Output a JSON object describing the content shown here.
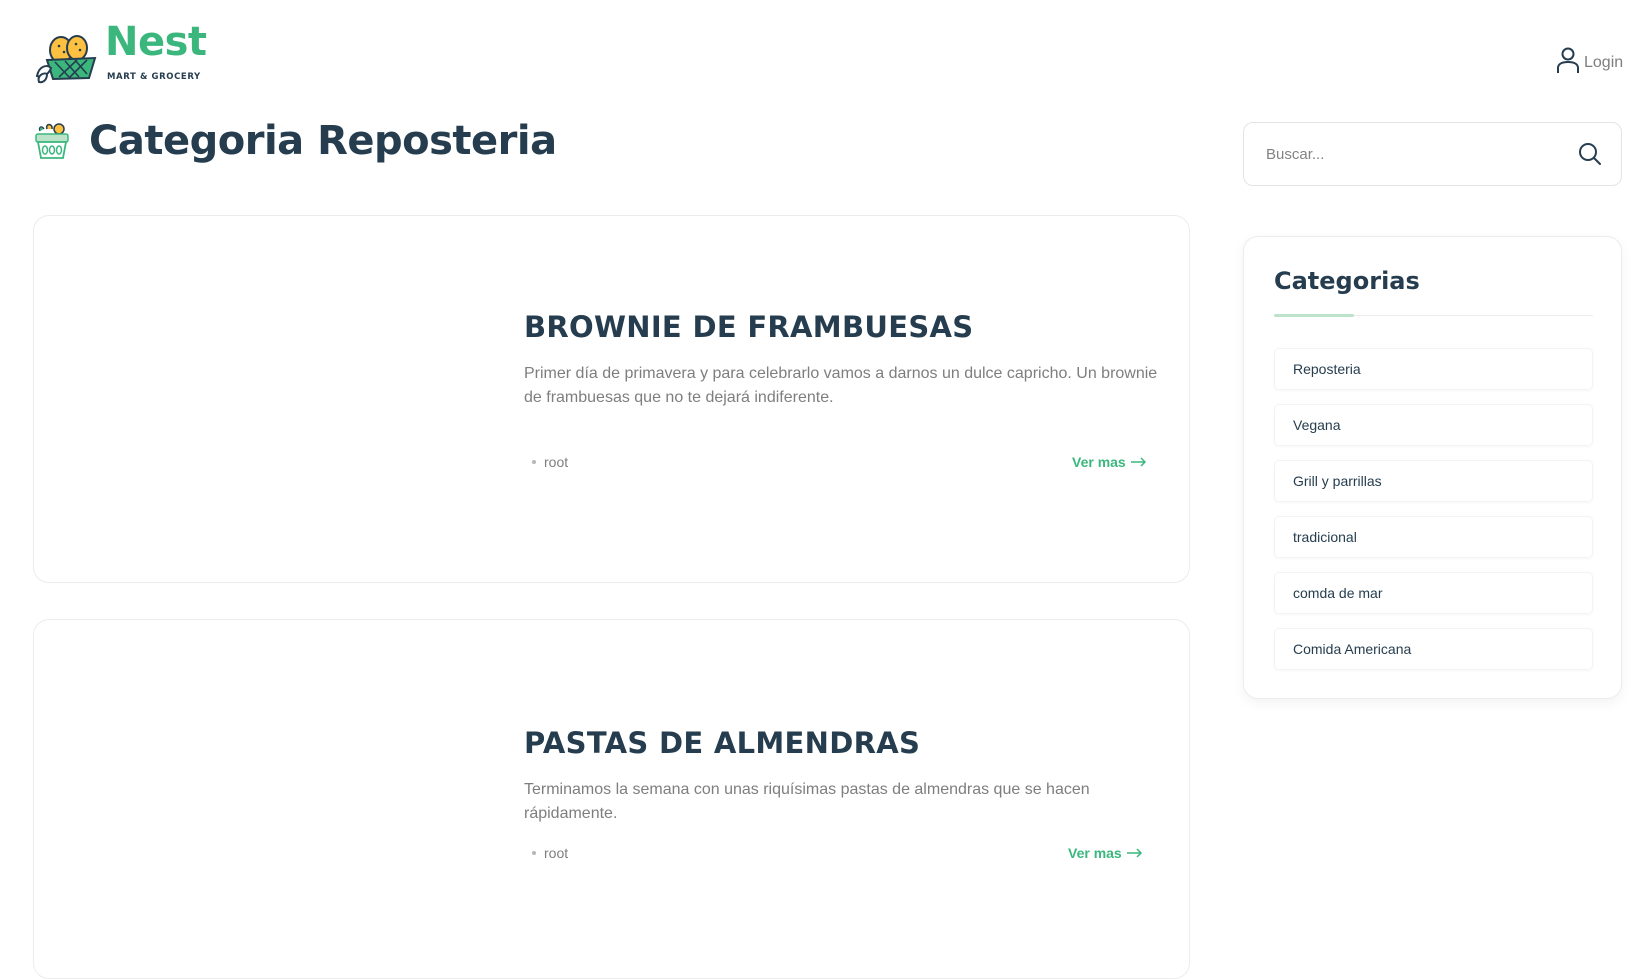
{
  "header": {
    "logo_name": "Nest",
    "logo_tagline": "MART & GROCERY",
    "login_label": "Login"
  },
  "page": {
    "title": "Categoria Reposteria"
  },
  "posts": [
    {
      "title": "BROWNIE DE FRAMBUESAS",
      "excerpt": "Primer día de primavera y para celebrarlo vamos a darnos un dulce capricho. Un brownie de frambuesas que no te dejará indiferente.",
      "author": "root",
      "read_more": "Ver mas"
    },
    {
      "title": "PASTAS DE ALMENDRAS",
      "excerpt": "Terminamos la semana con unas riquísimas pastas de almendras que se hacen rápidamente.",
      "author": "root",
      "read_more": "Ver mas"
    }
  ],
  "sidebar": {
    "search": {
      "placeholder": "Buscar..."
    },
    "categories": {
      "title": "Categorias",
      "items": [
        "Reposteria",
        "Vegana",
        "Grill y parrillas",
        "tradicional",
        "comda de mar",
        "Comida Americana"
      ]
    }
  },
  "colors": {
    "brand": "#3bb77e",
    "heading": "#253d4e",
    "muted": "#7e7e7e"
  }
}
